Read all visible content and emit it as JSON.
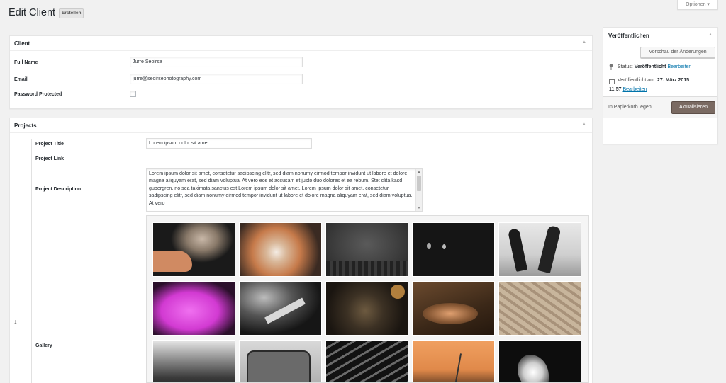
{
  "header": {
    "title": "Edit Client",
    "add_new_label": "Erstellen",
    "screen_options_label": "Optionen ▾"
  },
  "client_box": {
    "title": "Client",
    "fields": {
      "full_name_label": "Full Name",
      "full_name_value": "Jurre Seoirse",
      "email_label": "Email",
      "email_value": "jurre@seoirsephotography.com",
      "password_label": "Password Protected",
      "password_checked": false
    }
  },
  "projects_box": {
    "title": "Projects",
    "row_number": "1",
    "project_title_label": "Project Title",
    "project_title_value": "Lorem ipsum dolor sit amet",
    "project_link_label": "Project Link",
    "project_description_label": "Project Description",
    "project_description_value": "Lorem ipsum dolor sit amet, consetetur sadipscing elitr, sed diam nonumy eirmod tempor invidunt ut labore et dolore magna aliquyam erat, sed diam voluptua. At vero eos et accusam et justo duo dolores et ea rebum. Stet clita kasd gubergren, no sea takimata sanctus est Lorem ipsum dolor sit amet. Lorem ipsum dolor sit amet, consetetur sadipscing elitr, sed diam nonumy eirmod tempor invidunt ut labore et dolore magna aliquyam erat, sed diam voluptua. At vero",
    "gallery_label": "Gallery",
    "gallery_images": [
      "kitten-photo",
      "light-bokeh-photo",
      "dark-texture-photo",
      "night-moon-photo",
      "dancers-photo",
      "magenta-glow-photo",
      "guitarist-photo",
      "glass-bokeh-photo",
      "food-bowl-photo",
      "woven-texture-photo",
      "storm-clouds-photo",
      "vintage-van-photo",
      "light-stripes-photo",
      "orange-sky-photo",
      "splash-photo"
    ]
  },
  "publish_box": {
    "title": "Veröffentlichen",
    "preview_button": "Vorschau der Änderungen",
    "status_prefix": "Status:",
    "status_value": "Veröffentlicht",
    "status_edit": "Bearbeiten",
    "published_prefix": "Veröffentlicht am:",
    "published_date": "27. März 2015",
    "published_time": "11:57",
    "published_edit": "Bearbeiten",
    "trash_label": "In Papierkorb legen",
    "update_button": "Aktualisieren"
  },
  "colors": {
    "primary_button": "#7a6a62",
    "link": "#0073aa",
    "background": "#f1f1f1"
  }
}
